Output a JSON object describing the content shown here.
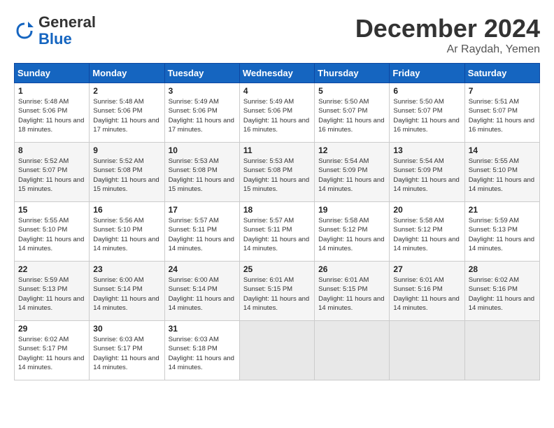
{
  "logo": {
    "general": "General",
    "blue": "Blue"
  },
  "header": {
    "month_title": "December 2024",
    "location": "Ar Raydah, Yemen"
  },
  "days_of_week": [
    "Sunday",
    "Monday",
    "Tuesday",
    "Wednesday",
    "Thursday",
    "Friday",
    "Saturday"
  ],
  "weeks": [
    [
      {
        "day": 1,
        "sunrise": "5:48 AM",
        "sunset": "5:06 PM",
        "daylight": "11 hours and 18 minutes."
      },
      {
        "day": 2,
        "sunrise": "5:48 AM",
        "sunset": "5:06 PM",
        "daylight": "11 hours and 17 minutes."
      },
      {
        "day": 3,
        "sunrise": "5:49 AM",
        "sunset": "5:06 PM",
        "daylight": "11 hours and 17 minutes."
      },
      {
        "day": 4,
        "sunrise": "5:49 AM",
        "sunset": "5:06 PM",
        "daylight": "11 hours and 16 minutes."
      },
      {
        "day": 5,
        "sunrise": "5:50 AM",
        "sunset": "5:07 PM",
        "daylight": "11 hours and 16 minutes."
      },
      {
        "day": 6,
        "sunrise": "5:50 AM",
        "sunset": "5:07 PM",
        "daylight": "11 hours and 16 minutes."
      },
      {
        "day": 7,
        "sunrise": "5:51 AM",
        "sunset": "5:07 PM",
        "daylight": "11 hours and 16 minutes."
      }
    ],
    [
      {
        "day": 8,
        "sunrise": "5:52 AM",
        "sunset": "5:07 PM",
        "daylight": "11 hours and 15 minutes."
      },
      {
        "day": 9,
        "sunrise": "5:52 AM",
        "sunset": "5:08 PM",
        "daylight": "11 hours and 15 minutes."
      },
      {
        "day": 10,
        "sunrise": "5:53 AM",
        "sunset": "5:08 PM",
        "daylight": "11 hours and 15 minutes."
      },
      {
        "day": 11,
        "sunrise": "5:53 AM",
        "sunset": "5:08 PM",
        "daylight": "11 hours and 15 minutes."
      },
      {
        "day": 12,
        "sunrise": "5:54 AM",
        "sunset": "5:09 PM",
        "daylight": "11 hours and 14 minutes."
      },
      {
        "day": 13,
        "sunrise": "5:54 AM",
        "sunset": "5:09 PM",
        "daylight": "11 hours and 14 minutes."
      },
      {
        "day": 14,
        "sunrise": "5:55 AM",
        "sunset": "5:10 PM",
        "daylight": "11 hours and 14 minutes."
      }
    ],
    [
      {
        "day": 15,
        "sunrise": "5:55 AM",
        "sunset": "5:10 PM",
        "daylight": "11 hours and 14 minutes."
      },
      {
        "day": 16,
        "sunrise": "5:56 AM",
        "sunset": "5:10 PM",
        "daylight": "11 hours and 14 minutes."
      },
      {
        "day": 17,
        "sunrise": "5:57 AM",
        "sunset": "5:11 PM",
        "daylight": "11 hours and 14 minutes."
      },
      {
        "day": 18,
        "sunrise": "5:57 AM",
        "sunset": "5:11 PM",
        "daylight": "11 hours and 14 minutes."
      },
      {
        "day": 19,
        "sunrise": "5:58 AM",
        "sunset": "5:12 PM",
        "daylight": "11 hours and 14 minutes."
      },
      {
        "day": 20,
        "sunrise": "5:58 AM",
        "sunset": "5:12 PM",
        "daylight": "11 hours and 14 minutes."
      },
      {
        "day": 21,
        "sunrise": "5:59 AM",
        "sunset": "5:13 PM",
        "daylight": "11 hours and 14 minutes."
      }
    ],
    [
      {
        "day": 22,
        "sunrise": "5:59 AM",
        "sunset": "5:13 PM",
        "daylight": "11 hours and 14 minutes."
      },
      {
        "day": 23,
        "sunrise": "6:00 AM",
        "sunset": "5:14 PM",
        "daylight": "11 hours and 14 minutes."
      },
      {
        "day": 24,
        "sunrise": "6:00 AM",
        "sunset": "5:14 PM",
        "daylight": "11 hours and 14 minutes."
      },
      {
        "day": 25,
        "sunrise": "6:01 AM",
        "sunset": "5:15 PM",
        "daylight": "11 hours and 14 minutes."
      },
      {
        "day": 26,
        "sunrise": "6:01 AM",
        "sunset": "5:15 PM",
        "daylight": "11 hours and 14 minutes."
      },
      {
        "day": 27,
        "sunrise": "6:01 AM",
        "sunset": "5:16 PM",
        "daylight": "11 hours and 14 minutes."
      },
      {
        "day": 28,
        "sunrise": "6:02 AM",
        "sunset": "5:16 PM",
        "daylight": "11 hours and 14 minutes."
      }
    ],
    [
      {
        "day": 29,
        "sunrise": "6:02 AM",
        "sunset": "5:17 PM",
        "daylight": "11 hours and 14 minutes."
      },
      {
        "day": 30,
        "sunrise": "6:03 AM",
        "sunset": "5:17 PM",
        "daylight": "11 hours and 14 minutes."
      },
      {
        "day": 31,
        "sunrise": "6:03 AM",
        "sunset": "5:18 PM",
        "daylight": "11 hours and 14 minutes."
      },
      null,
      null,
      null,
      null
    ]
  ]
}
